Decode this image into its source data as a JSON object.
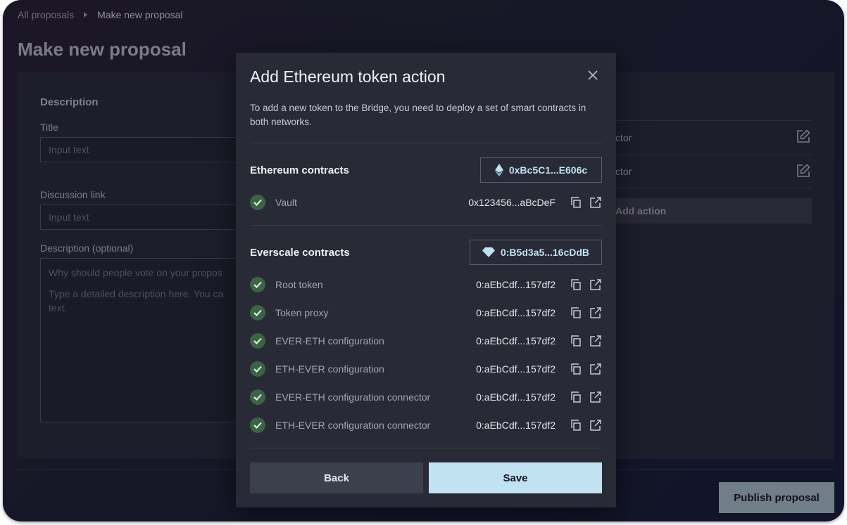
{
  "breadcrumb": {
    "parent": "All proposals",
    "current": "Make new proposal"
  },
  "page": {
    "title": "Make new proposal",
    "description_section": "Description",
    "title_label": "Title",
    "title_placeholder": "Input text",
    "discussion_label": "Discussion link",
    "discussion_placeholder": "Input text",
    "desc_optional_label": "Description (optional)",
    "desc_placeholder_line1": "Why should people vote on your propos",
    "desc_placeholder_line2": "Type a detailed description here. You ca",
    "desc_placeholder_line3": "text.",
    "actions": [
      {
        "label": "ctor",
        "icon": "edit-icon"
      },
      {
        "label": "ctor",
        "icon": "edit-icon"
      }
    ],
    "add_action": "Add action",
    "publish": "Publish proposal"
  },
  "modal": {
    "title": "Add Ethereum token action",
    "description": "To add a new token to the Bridge, you need to deploy a set of smart contracts in both networks.",
    "ethereum": {
      "heading": "Ethereum contracts",
      "address": "0xBc5C1...E606c",
      "icon": "ethereum-icon",
      "contracts": [
        {
          "label": "Vault",
          "value": "0x123456...aBcDeF"
        }
      ]
    },
    "everscale": {
      "heading": "Everscale contracts",
      "address": "0:B5d3a5...16cDdB",
      "icon": "everscale-diamond-icon",
      "contracts": [
        {
          "label": "Root token",
          "value": "0:aEbCdf...157df2"
        },
        {
          "label": "Token proxy",
          "value": "0:aEbCdf...157df2"
        },
        {
          "label": "EVER-ETH configuration",
          "value": "0:aEbCdf...157df2"
        },
        {
          "label": "ETH-EVER configuration",
          "value": "0:aEbCdf...157df2"
        },
        {
          "label": "EVER-ETH configuration connector",
          "value": "0:aEbCdf...157df2"
        },
        {
          "label": "ETH-EVER configuration connector",
          "value": "0:aEbCdf...157df2"
        }
      ]
    },
    "back": "Back",
    "save": "Save"
  },
  "colors": {
    "accent": "#c0e2f1",
    "check": "#3b6444",
    "modal_bg": "#282a36"
  }
}
